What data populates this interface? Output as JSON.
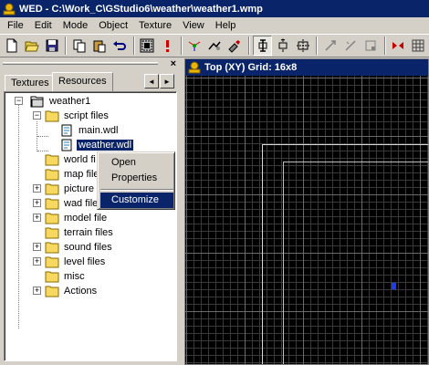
{
  "window": {
    "title": "WED - C:\\Work_C\\GStudio6\\weather\\weather1.wmp"
  },
  "menu": [
    "File",
    "Edit",
    "Mode",
    "Object",
    "Texture",
    "View",
    "Help"
  ],
  "toolbar": {
    "icons": [
      "new-icon",
      "open-icon",
      "save-icon",
      "copy-icon",
      "paste-icon",
      "undo-icon",
      "build-icon",
      "run-icon",
      "scene-icon",
      "camera-icon",
      "tool-icon",
      "object-move-icon",
      "object-rotate-icon",
      "object-scale-icon",
      "vertex-move-icon",
      "vertex-rotate-icon",
      "vertex-scale-icon",
      "mirror-icon",
      "grid-snap-icon"
    ]
  },
  "left_pane": {
    "close_label": "×",
    "tabs": [
      {
        "label": "Textures",
        "active": false
      },
      {
        "label": "Resources",
        "active": true
      }
    ],
    "scroll_left": "◄",
    "scroll_right": "►"
  },
  "tree": {
    "root": "weather1",
    "items": [
      {
        "label": "script files",
        "expander": "−"
      },
      {
        "label": "main.wdl"
      },
      {
        "label": "weather.wdl"
      },
      {
        "label": "world fi",
        "expander": null
      },
      {
        "label": "map file",
        "expander": null
      },
      {
        "label": "picture",
        "expander": "+"
      },
      {
        "label": "wad file",
        "expander": "+"
      },
      {
        "label": "model file",
        "expander": "+"
      },
      {
        "label": "terrain files",
        "expander": null
      },
      {
        "label": "sound files",
        "expander": "+"
      },
      {
        "label": "level files",
        "expander": "+"
      },
      {
        "label": "misc",
        "expander": null
      },
      {
        "label": "Actions",
        "expander": "+"
      }
    ],
    "root_expander": "−"
  },
  "context_menu": {
    "items": [
      "Open",
      "Properties",
      "Customize"
    ],
    "highlighted": "Customize"
  },
  "view": {
    "title": "Top (XY) Grid: 16x8"
  },
  "colors": {
    "title_bar": "#0a246a",
    "face": "#d4d0c8",
    "grid_bg": "#000000",
    "marker": "#1a3cff"
  }
}
